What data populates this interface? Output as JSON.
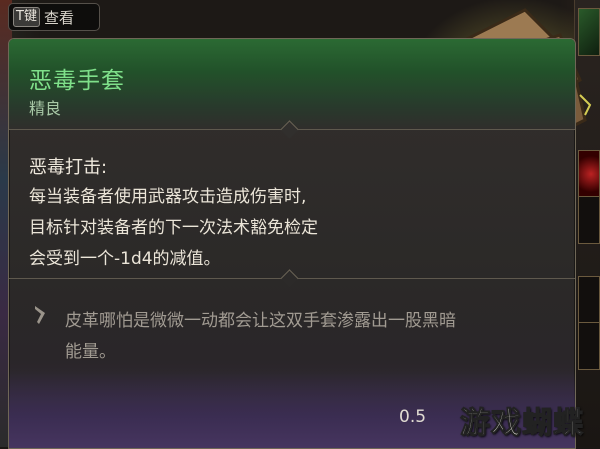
{
  "key_hint": {
    "key": "T键",
    "label": "查看"
  },
  "item": {
    "name": "恶毒手套",
    "rarity": "精良",
    "ability_title": "恶毒打击:",
    "description_lines": [
      "每当装备者使用武器攻击造成伤害时,",
      "目标针对装备者的下一次法术豁免检定",
      "会受到一个-1d4的减值。"
    ],
    "flavor_lines": [
      "皮革哪怕是微微一动都会让这双手套渗露出一股黑暗",
      "能量。"
    ],
    "weight": "0.5"
  },
  "watermark": "游戏蝴蝶",
  "colors": {
    "rarity_green": "#7fe08a",
    "header_green": "#2b6a33",
    "text": "#ebe5d8",
    "flavor_text": "#a19b92"
  }
}
